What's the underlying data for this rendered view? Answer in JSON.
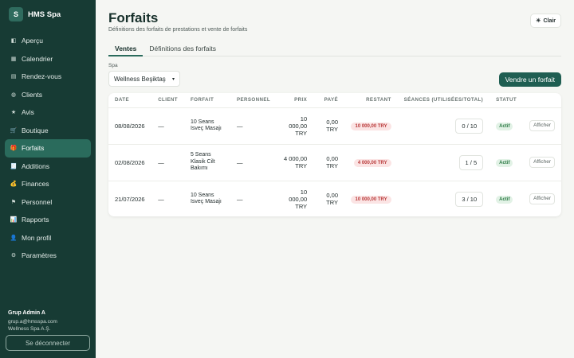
{
  "brand": {
    "logo_letter": "S",
    "name": "HMS Spa"
  },
  "nav": [
    {
      "icon": "◧",
      "label": "Aperçu",
      "name": "sidebar-item-apercu",
      "icon_name": "overview-icon"
    },
    {
      "icon": "▦",
      "label": "Calendrier",
      "name": "sidebar-item-calendrier",
      "icon_name": "calendar-icon"
    },
    {
      "icon": "▤",
      "label": "Rendez-vous",
      "name": "sidebar-item-rendez-vous",
      "icon_name": "appointments-icon"
    },
    {
      "icon": "◍",
      "label": "Clients",
      "name": "sidebar-item-clients",
      "icon_name": "clients-icon"
    },
    {
      "icon": "★",
      "label": "Avis",
      "name": "sidebar-item-avis",
      "icon_name": "star-icon"
    },
    {
      "icon": "🛒",
      "label": "Boutique",
      "name": "sidebar-item-boutique",
      "icon_name": "cart-icon"
    },
    {
      "icon": "🎁",
      "label": "Forfaits",
      "name": "sidebar-item-forfaits",
      "icon_name": "gift-icon",
      "active": true
    },
    {
      "icon": "🧾",
      "label": "Additions",
      "name": "sidebar-item-additions",
      "icon_name": "receipt-icon"
    },
    {
      "icon": "💰",
      "label": "Finances",
      "name": "sidebar-item-finances",
      "icon_name": "money-bag-icon"
    },
    {
      "icon": "⚑",
      "label": "Personnel",
      "name": "sidebar-item-personnel",
      "icon_name": "staff-icon"
    },
    {
      "icon": "📊",
      "label": "Rapports",
      "name": "sidebar-item-rapports",
      "icon_name": "chart-icon"
    },
    {
      "icon": "👤",
      "label": "Mon profil",
      "name": "sidebar-item-mon-profil",
      "icon_name": "user-icon"
    },
    {
      "icon": "⚙",
      "label": "Paramètres",
      "name": "sidebar-item-parametres",
      "icon_name": "gear-icon"
    }
  ],
  "user": {
    "name": "Grup Admin A",
    "email": "grup.a@hmsspa.com",
    "company": "Wellness Spa A.Ş."
  },
  "logout_label": "Se déconnecter",
  "header": {
    "title": "Forfaits",
    "subtitle": "Définitions des forfaits de prestations et vente de forfaits",
    "theme_icon": "☀",
    "theme_label": "Clair"
  },
  "tabs": [
    {
      "label": "Ventes",
      "active": true
    },
    {
      "label": "Définitions des forfaits",
      "active": false
    }
  ],
  "filter": {
    "spa_label": "Spa",
    "spa_value": "Wellness Beşiktaş",
    "chevron": "▾"
  },
  "sell_button": "Vendre un forfait",
  "table": {
    "columns": [
      "DATE",
      "CLIENT",
      "FORFAIT",
      "PERSONNEL",
      "PRIX",
      "PAYÉ",
      "RESTANT",
      "SÉANCES (UTILISÉES/TOTAL)",
      "STATUT",
      ""
    ],
    "rows": [
      {
        "date": "08/08/2026",
        "client": "—",
        "package": "10 Seans Isveç Masajı",
        "staff": "—",
        "price": "10 000,00 TRY",
        "paid": "0,00 TRY",
        "remaining": "10 000,00 TRY",
        "sessions": "0 / 10",
        "status": "Actif",
        "action": "Afficher"
      },
      {
        "date": "02/08/2026",
        "client": "—",
        "package": "5 Seans Klasik Cilt Bakımı",
        "staff": "—",
        "price": "4 000,00 TRY",
        "paid": "0,00 TRY",
        "remaining": "4 000,00 TRY",
        "sessions": "1 / 5",
        "status": "Actif",
        "action": "Afficher"
      },
      {
        "date": "21/07/2026",
        "client": "—",
        "package": "10 Seans Isveç Masajı",
        "staff": "—",
        "price": "10 000,00 TRY",
        "paid": "0,00 TRY",
        "remaining": "10 000,00 TRY",
        "sessions": "3 / 10",
        "status": "Actif",
        "action": "Afficher"
      }
    ]
  },
  "colors": {
    "sidebar_bg": "#173b34",
    "accent": "#2a6b5c",
    "primary_button": "#1f5e52",
    "danger_badge": "#b93b3b",
    "success_badge": "#2b7a44"
  }
}
